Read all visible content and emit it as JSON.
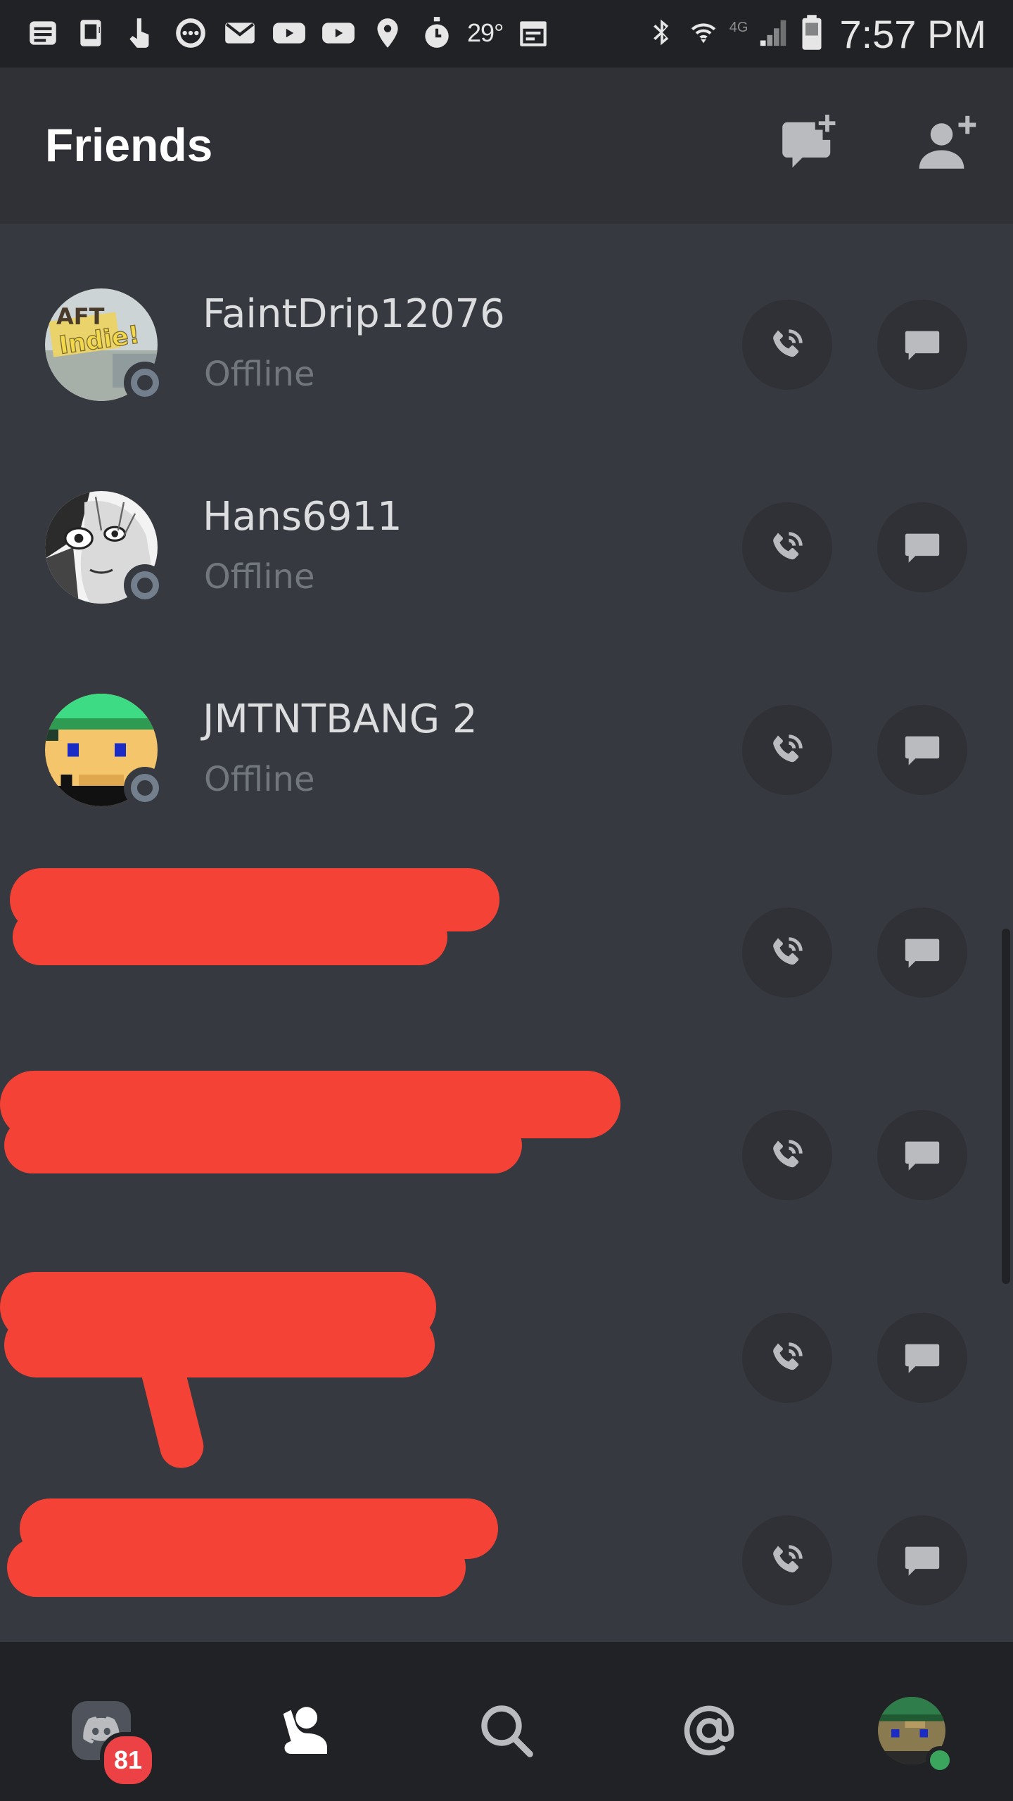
{
  "status_bar": {
    "temperature": "29°",
    "network": "4G",
    "time": "7:57 PM",
    "icons_left": [
      "news-icon",
      "sim-icon",
      "touch-icon",
      "messaging-icon",
      "mail-icon",
      "youtube-icon",
      "youtube-icon",
      "location-icon",
      "timer-icon",
      "calendar-icon"
    ],
    "icons_right": [
      "bluetooth-icon",
      "wifi-icon",
      "signal-icon",
      "battery-icon"
    ]
  },
  "header": {
    "title": "Friends",
    "new_dm_icon": "new-message-icon",
    "add_friend_icon": "add-friend-icon"
  },
  "friends": [
    {
      "name": "FaintDrip12076",
      "status": "Offline"
    },
    {
      "name": "Hans6911",
      "status": "Offline"
    },
    {
      "name": "JMTNTBANG 2",
      "status": "Offline"
    },
    {
      "name": "",
      "status": ""
    },
    {
      "name": "",
      "status": ""
    },
    {
      "name": "",
      "status": ""
    },
    {
      "name": "",
      "status": ""
    }
  ],
  "bottom_nav": {
    "home_badge": "81",
    "items": [
      "home",
      "friends",
      "search",
      "mentions",
      "profile"
    ]
  },
  "colors": {
    "background": "#36393f",
    "header": "#2f3136",
    "nav": "#202225",
    "badge": "#ed4245",
    "offline": "#747f8d",
    "online": "#3ba55d",
    "redaction": "#f44336"
  }
}
